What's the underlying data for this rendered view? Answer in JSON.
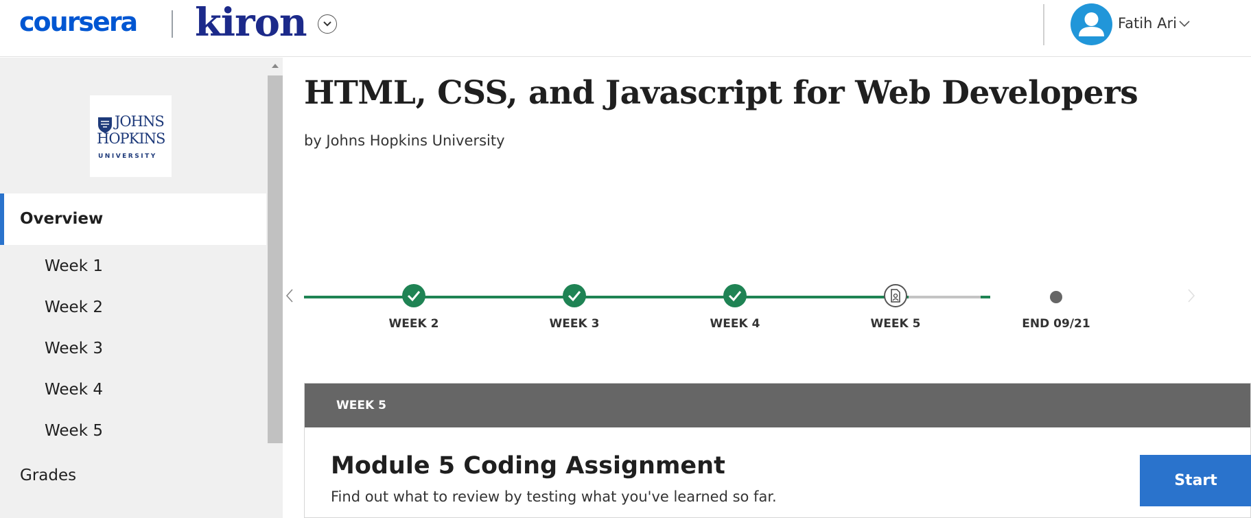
{
  "header": {
    "brand_primary": "coursera",
    "brand_partner": "kiron",
    "user_name": "Fatih Ari"
  },
  "sidebar": {
    "logo": {
      "line1": "JOHNS",
      "line2": "HOPKINS",
      "line3": "UNIVERSITY"
    },
    "items": [
      {
        "label": "Overview",
        "active": true
      },
      {
        "label": "Week 1"
      },
      {
        "label": "Week 2"
      },
      {
        "label": "Week 3"
      },
      {
        "label": "Week 4"
      },
      {
        "label": "Week 5"
      },
      {
        "label": "Grades"
      }
    ]
  },
  "course": {
    "title": "HTML, CSS, and Javascript for Web Developers",
    "by": "by Johns Hopkins University"
  },
  "timeline": {
    "milestones": [
      {
        "label": "WEEK 2",
        "status": "completed"
      },
      {
        "label": "WEEK 3",
        "status": "completed"
      },
      {
        "label": "WEEK 4",
        "status": "completed"
      },
      {
        "label": "WEEK 5",
        "status": "current"
      },
      {
        "label": "END 09/21",
        "status": "end"
      }
    ]
  },
  "module": {
    "week_label": "WEEK 5",
    "title": "Module 5 Coding Assignment",
    "description": "Find out what to review by testing what you've learned so far.",
    "start_label": "Start"
  },
  "colors": {
    "accent": "#2a73cc",
    "brand_blue": "#0056d2",
    "kiron_navy": "#1c2a8a",
    "complete_green": "#1f8354",
    "header_gray": "#666666"
  }
}
